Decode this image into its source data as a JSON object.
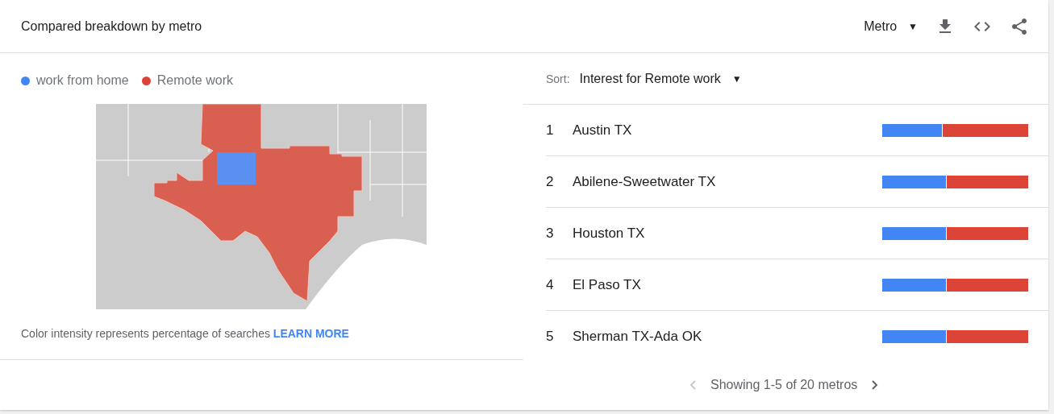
{
  "header": {
    "title": "Compared breakdown by metro",
    "dropdown": {
      "label": "Metro",
      "caret": "▼"
    }
  },
  "legend": [
    {
      "label": "work from home",
      "color": "#4285f4"
    },
    {
      "label": "Remote work",
      "color": "#db4437"
    }
  ],
  "note": {
    "text": "Color intensity represents percentage of searches",
    "link": "LEARN MORE"
  },
  "sort": {
    "label": "Sort:",
    "value": "Interest for Remote work",
    "caret": "▼"
  },
  "rows": [
    {
      "rank": "1",
      "name": "Austin TX",
      "level": 0.41
    },
    {
      "rank": "2",
      "name": "Abilene-Sweetwater TX",
      "level": 0.435
    },
    {
      "rank": "3",
      "name": "Houston TX",
      "level": 0.435
    },
    {
      "rank": "4",
      "name": "El Paso TX",
      "level": 0.435
    },
    {
      "rank": "5",
      "name": "Sherman TX-Ada OK",
      "level": 0.435
    }
  ],
  "pagination": {
    "text": "Showing 1-5 of 20 metros",
    "prev_disabled": true,
    "next_disabled": false
  }
}
